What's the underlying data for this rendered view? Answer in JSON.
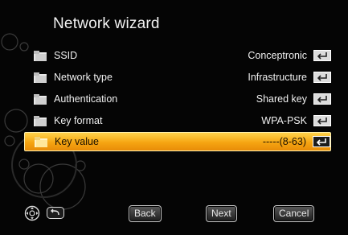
{
  "title": "Network wizard",
  "rows": [
    {
      "label": "SSID",
      "value": "Conceptronic"
    },
    {
      "label": "Network type",
      "value": "Infrastructure"
    },
    {
      "label": "Authentication",
      "value": "Shared key"
    },
    {
      "label": "Key format",
      "value": "WPA-PSK"
    },
    {
      "label": "Key value",
      "value": "-----(8-63)"
    }
  ],
  "selected_row": "Key value",
  "buttons": {
    "back": "Back",
    "next": "Next",
    "cancel": "Cancel"
  },
  "colors": {
    "highlight": "#f6a512",
    "background": "#050505",
    "text": "#f0f0f0"
  },
  "icons": {
    "row": "folder-icon",
    "enter": "enter-key-icon",
    "nav": "dpad-icon",
    "return": "return-icon"
  }
}
